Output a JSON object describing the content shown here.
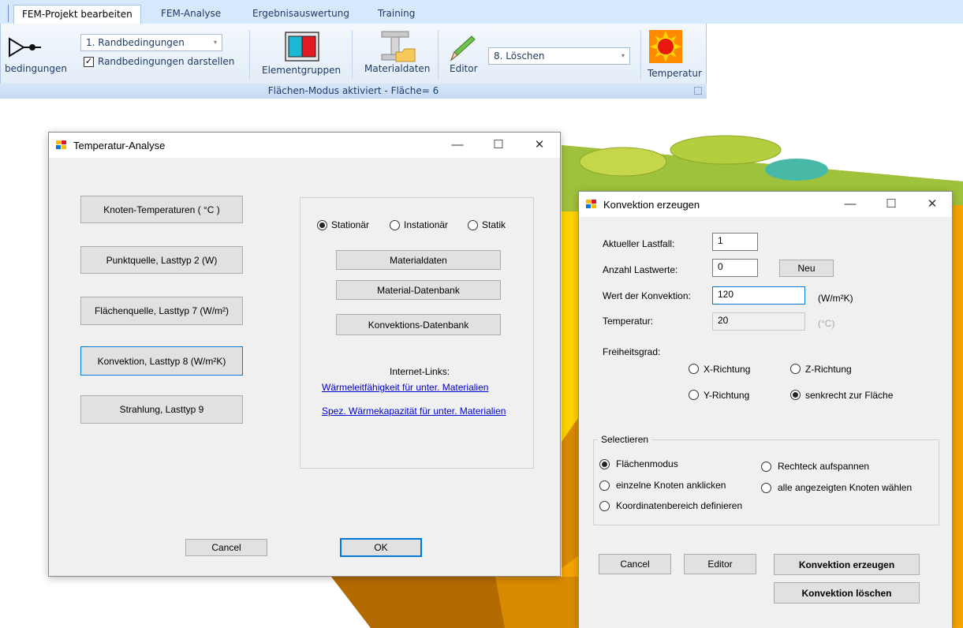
{
  "ribbon": {
    "tabs": [
      "FEM-Projekt bearbeiten",
      "FEM-Analyse",
      "Ergebnisauswertung",
      "Training"
    ],
    "active_tab": "FEM-Projekt bearbeiten",
    "randbedingungen_label": "bedingungen",
    "boundary_combo_value": "1.  Randbedingungen",
    "show_boundary_checkbox_label": "Randbedingungen darstellen",
    "show_boundary_checked": true,
    "elementgruppen_label": "Elementgruppen",
    "materialdaten_label": "Materialdaten",
    "editor_label": "Editor",
    "action_combo_value": "8.  Löschen",
    "temperatur_label": "Temperatur",
    "status_text": "Flächen-Modus aktiviert - Fläche=  6",
    "checkmark": "✓",
    "dropdown_arrow": "▾"
  },
  "temperature_window": {
    "title": "Temperatur-Analyse",
    "controls": {
      "minimize": "—",
      "maximize": "☐",
      "close": "✕"
    },
    "load_buttons": [
      "Knoten-Temperaturen ( °C )",
      "Punktquelle,  Lasttyp 2  (W)",
      "Flächenquelle, Lasttyp 7  (W/m²)",
      "Konvektion, Lasttyp 8 (W/m²K)",
      "Strahlung, Lasttyp 9"
    ],
    "analysis_modes": [
      "Stationär",
      "Instationär",
      "Statik"
    ],
    "selected_mode": "Stationär",
    "material_buttons": [
      "Materialdaten",
      "Material-Datenbank",
      "Konvektions-Datenbank"
    ],
    "internet_links_label": "Internet-Links:",
    "links": [
      "Wärmeleitfähigkeit für unter. Materialien",
      "Spez. Wärmekapazität für unter. Materialien"
    ],
    "cancel_label": "Cancel",
    "ok_label": "OK"
  },
  "convection_window": {
    "title": "Konvektion erzeugen",
    "controls": {
      "minimize": "—",
      "maximize": "☐",
      "close": "✕"
    },
    "current_loadcase_label": "Aktueller Lastfall:",
    "current_loadcase_value": "1",
    "num_loadvalues_label": "Anzahl Lastwerte:",
    "num_loadvalues_value": "0",
    "new_button": "Neu",
    "convection_value_label": "Wert der Konvektion:",
    "convection_value": "120",
    "convection_unit": "(W/m²K)",
    "temperature_label": "Temperatur:",
    "temperature_value": "20",
    "temperature_unit": "(°C)",
    "dof_label": "Freiheitsgrad:",
    "dof_options": [
      "X-Richtung",
      "Z-Richtung",
      "Y-Richtung",
      "senkrecht zur Fläche"
    ],
    "dof_selected": "senkrecht zur Fläche",
    "select_group_label": "Selectieren",
    "select_options": [
      "Flächenmodus",
      "Rechteck aufspannen",
      "einzelne Knoten anklicken",
      "alle angezeigten Knoten wählen",
      "Koordinatenbereich definieren"
    ],
    "select_selected": "Flächenmodus",
    "cancel_label": "Cancel",
    "editor_label": "Editor",
    "create_label": "Konvektion erzeugen",
    "delete_label": "Konvektion löschen"
  }
}
